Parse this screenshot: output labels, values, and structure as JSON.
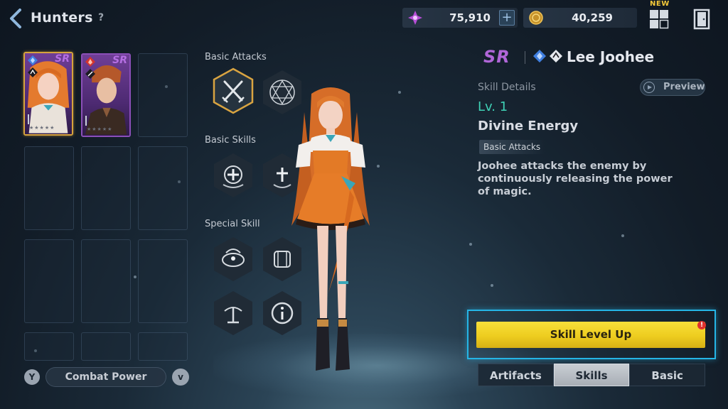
{
  "header": {
    "title": "Hunters",
    "help": "?",
    "gems": {
      "value": "75,910",
      "plus": "+"
    },
    "gold": {
      "value": "40,259"
    },
    "new_badge": "NEW"
  },
  "hunters": [
    {
      "rank": "SR",
      "element_color": "#3f7fe0"
    },
    {
      "rank": "SR",
      "element_color": "#d2352f"
    }
  ],
  "sort": {
    "label": "Combat Power",
    "filter_icon": "Y",
    "dir_icon": "v"
  },
  "skills": {
    "basic_attacks_label": "Basic Attacks",
    "basic_skills_label": "Basic Skills",
    "special_skill_label": "Special Skill"
  },
  "detail": {
    "rank": "SR",
    "name": "Lee Joohee",
    "section_label": "Skill Details",
    "preview_label": "Preview",
    "level": "Lv. 1",
    "skill_name": "Divine Energy",
    "skill_type": "Basic Attacks",
    "description": "Joohee attacks the enemy by continuously releasing the power of magic.",
    "level_up_label": "Skill Level Up",
    "alert": "!"
  },
  "tabs": [
    {
      "label": "Artifacts",
      "active": false
    },
    {
      "label": "Skills",
      "active": true
    },
    {
      "label": "Basic",
      "active": false
    }
  ],
  "colors": {
    "accent_gold": "#f2d22a",
    "rank_purple": "#b066d8",
    "level_teal": "#3fd1b5",
    "highlight_blue": "#25b5e6"
  }
}
